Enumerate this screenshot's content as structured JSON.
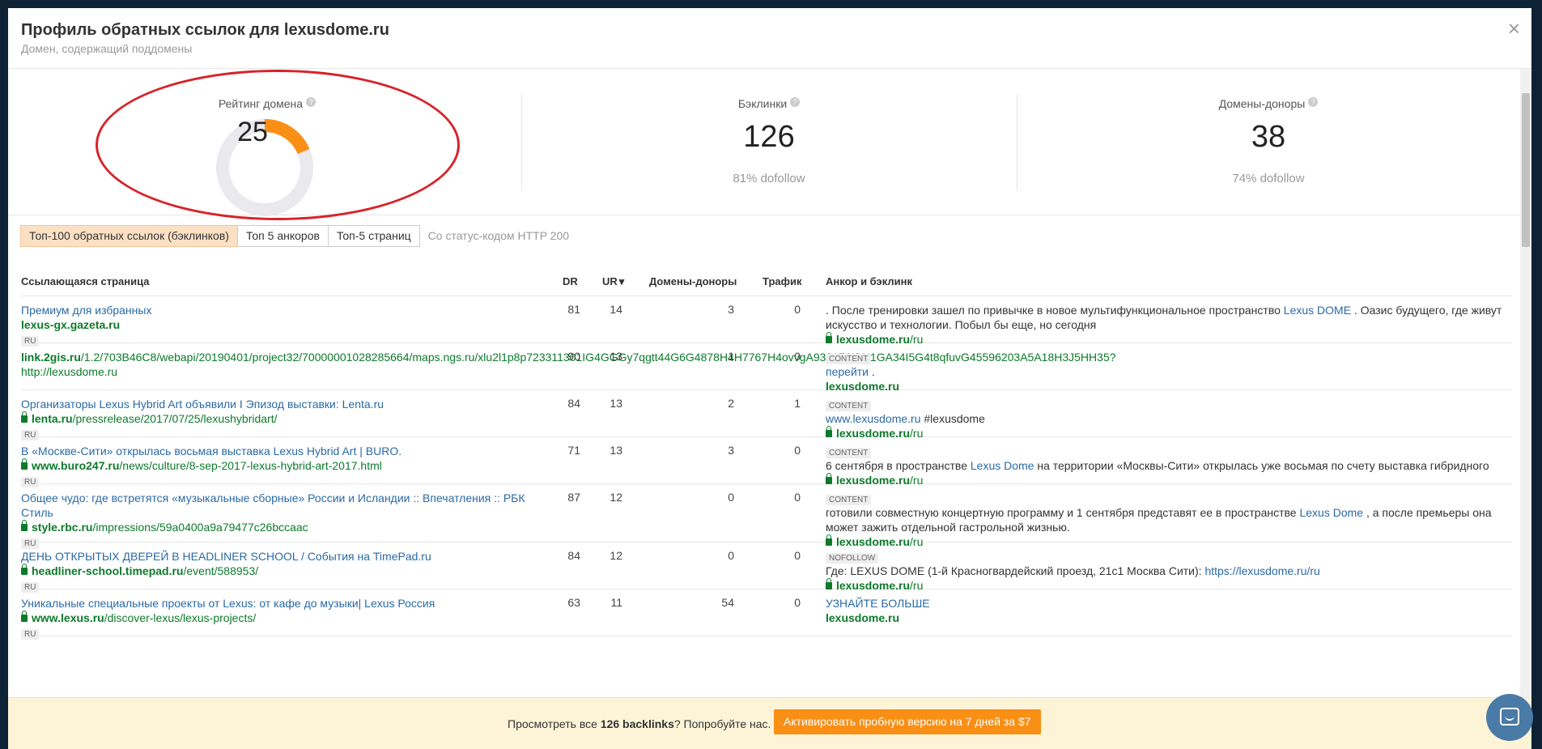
{
  "header": {
    "title": "Профиль обратных ссылок для lexusdome.ru",
    "subtitle": "Домен, содержащий поддомены",
    "close": "×"
  },
  "stats": {
    "rating": {
      "label": "Рейтинг домена",
      "value": "25",
      "fill_fraction": 0.25,
      "color": "#f98f14"
    },
    "backlinks": {
      "label": "Бэклинки",
      "value": "126",
      "sub": "81% dofollow"
    },
    "donors": {
      "label": "Домены-доноры",
      "value": "38",
      "sub": "74% dofollow"
    },
    "help_icon": "question-icon"
  },
  "tabs": {
    "items": [
      "Топ-100 обратных ссылок (бэклинков)",
      "Топ 5 анкоров",
      "Топ-5 страниц"
    ],
    "note": "Со статус-кодом HTTP 200"
  },
  "table": {
    "headers": {
      "page": "Ссылающаяся страница",
      "dr": "DR",
      "ur": "UR",
      "donors": "Домены-доноры",
      "traffic": "Трафик",
      "anchor": "Анкор и бэклинк"
    },
    "sort_arrow": "▾",
    "rows": [
      {
        "title": "Премиум для избранных",
        "domain": "lexus-gx.gazeta.ru",
        "path": "",
        "lang": "RU",
        "dr": "81",
        "ur": "14",
        "donors": "3",
        "traffic": "0",
        "tag": "",
        "anchor_pre": ". После тренировки зашел по привычке в новое мультифункциональное пространство ",
        "anchor_link": "Lexus DOME",
        "anchor_post": " . Оазис будущего, где живут искусство и технологии. Побыл бы еще, но сегодня",
        "target_domain": "lexusdome.ru",
        "target_path": "/ru"
      },
      {
        "title": "",
        "domain": "link.2gis.ru",
        "path": "/1.2/703B46C8/webapi/20190401/project32/70000001028285664/maps.ngs.ru/xlu2l1p8p723311301IG4GGGy7qgtt44G6G4878H4H7767H4ovvgA933176I21I1GA34I5G4t8qfuvG45596203A5A18H3J5HH35?http://lexusdome.ru",
        "lang": "",
        "dr": "90",
        "ur": "13",
        "donors": "1",
        "traffic": "0",
        "tag": "CONTENT",
        "anchor_pre": "",
        "anchor_link": "перейти",
        "anchor_post": " .",
        "target_domain": "lexusdome.ru",
        "target_path": ""
      },
      {
        "title": "Организаторы Lexus Hybrid Art объявили I Эпизод выставки: Lenta.ru",
        "domain": "lenta.ru",
        "path": "/pressrelease/2017/07/25/lexushybridart/",
        "lang": "RU",
        "dr": "84",
        "ur": "13",
        "donors": "2",
        "traffic": "1",
        "tag": "CONTENT",
        "anchor_pre": "",
        "anchor_link": "www.lexusdome.ru",
        "anchor_post": " #lexusdome",
        "target_domain": "lexusdome.ru",
        "target_path": "/ru"
      },
      {
        "title": "В «Москве-Сити» открылась восьмая выставка Lexus Hybrid Art | BURO.",
        "domain": "www.buro247.ru",
        "path": "/news/culture/8-sep-2017-lexus-hybrid-art-2017.html",
        "lang": "RU",
        "dr": "71",
        "ur": "13",
        "donors": "3",
        "traffic": "0",
        "tag": "CONTENT",
        "anchor_pre": "6 сентября в пространстве ",
        "anchor_link": "Lexus Dome",
        "anchor_post": " на территории «Москвы-Сити» открылась уже восьмая по счету выставка гибридного",
        "target_domain": "lexusdome.ru",
        "target_path": "/ru"
      },
      {
        "title": "Общее чудо: где встретятся «музыкальные сборные» России и Исландии :: Впечатления :: РБК Стиль",
        "domain": "style.rbc.ru",
        "path": "/impressions/59a0400a9a79477c26bccaac",
        "lang": "RU",
        "dr": "87",
        "ur": "12",
        "donors": "0",
        "traffic": "0",
        "tag": "CONTENT",
        "anchor_pre": "готовили совместную концертную программу и 1 сентября представят ее в пространстве ",
        "anchor_link": "Lexus Dome",
        "anchor_post": " , а после премьеры она может зажить отдельной гастрольной жизнью.",
        "target_domain": "lexusdome.ru",
        "target_path": "/ru"
      },
      {
        "title": "ДЕНЬ ОТКРЫТЫХ ДВЕРЕЙ В HEADLINER SCHOOL / События на TimePad.ru",
        "domain": "headliner-school.timepad.ru",
        "path": "/event/588953/",
        "lang": "RU",
        "dr": "84",
        "ur": "12",
        "donors": "0",
        "traffic": "0",
        "tag": "NOFOLLOW",
        "anchor_pre": "Где: LEXUS DOME (1-й Красногвардейский проезд, 21с1 Москва Сити): ",
        "anchor_link": "https://lexusdome.ru/ru",
        "anchor_post": "",
        "target_domain": "lexusdome.ru",
        "target_path": "/ru"
      },
      {
        "title": "Уникальные специальные проекты от Lexus: от кафе до музыки| Lexus Россия",
        "domain": "www.lexus.ru",
        "path": "/discover-lexus/lexus-projects/",
        "lang": "RU",
        "dr": "63",
        "ur": "11",
        "donors": "54",
        "traffic": "0",
        "tag": "",
        "anchor_pre": "",
        "anchor_link": "УЗНАЙТЕ БОЛЬШЕ",
        "anchor_post": "",
        "target_domain": "lexusdome.ru",
        "target_path": ""
      }
    ]
  },
  "footer": {
    "text_pre": "Просмотреть все ",
    "text_bold": "126 backlinks",
    "text_post": "? Попробуйте нас.",
    "button": "Активировать пробную версию на 7 дней за $7"
  }
}
